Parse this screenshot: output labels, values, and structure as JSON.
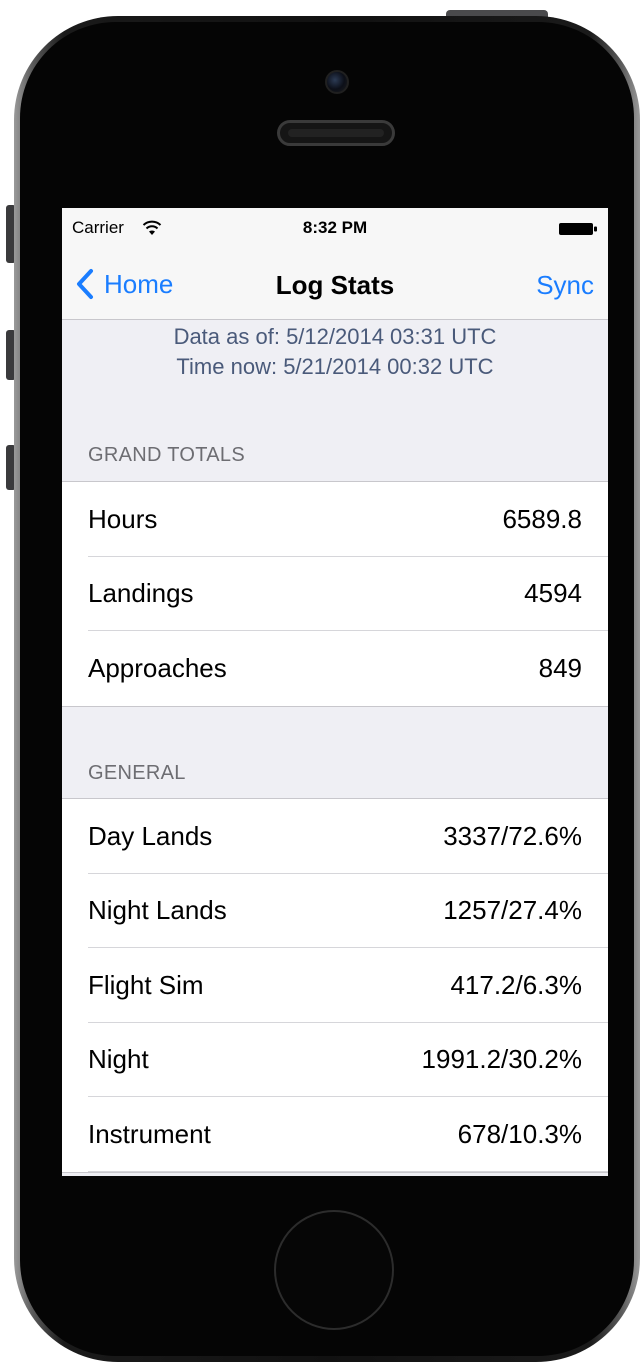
{
  "status_bar": {
    "carrier": "Carrier",
    "time": "8:32 PM"
  },
  "nav": {
    "back_label": "Home",
    "title": "Log Stats",
    "action_label": "Sync"
  },
  "data_info": {
    "data_as_of": "Data as of: 5/12/2014 03:31 UTC",
    "time_now": "Time now: 5/21/2014 00:32 UTC"
  },
  "grand_totals": {
    "header": "GRAND TOTALS",
    "rows": [
      {
        "label": "Hours",
        "value": "6589.8"
      },
      {
        "label": "Landings",
        "value": "4594"
      },
      {
        "label": "Approaches",
        "value": "849"
      }
    ]
  },
  "general": {
    "header": "GENERAL",
    "rows": [
      {
        "label": "Day Lands",
        "value": "3337/72.6%"
      },
      {
        "label": "Night Lands",
        "value": "1257/27.4%"
      },
      {
        "label": "Flight Sim",
        "value": "417.2/6.3%"
      },
      {
        "label": "Night",
        "value": "1991.2/30.2%"
      },
      {
        "label": "Instrument",
        "value": "678/10.3%"
      }
    ]
  },
  "colors": {
    "tint": "#1a7dff",
    "group_background": "#efeff4",
    "info_text": "#4a5a7a"
  },
  "icons": [
    "wifi-icon",
    "battery-icon",
    "chevron-left-icon"
  ]
}
